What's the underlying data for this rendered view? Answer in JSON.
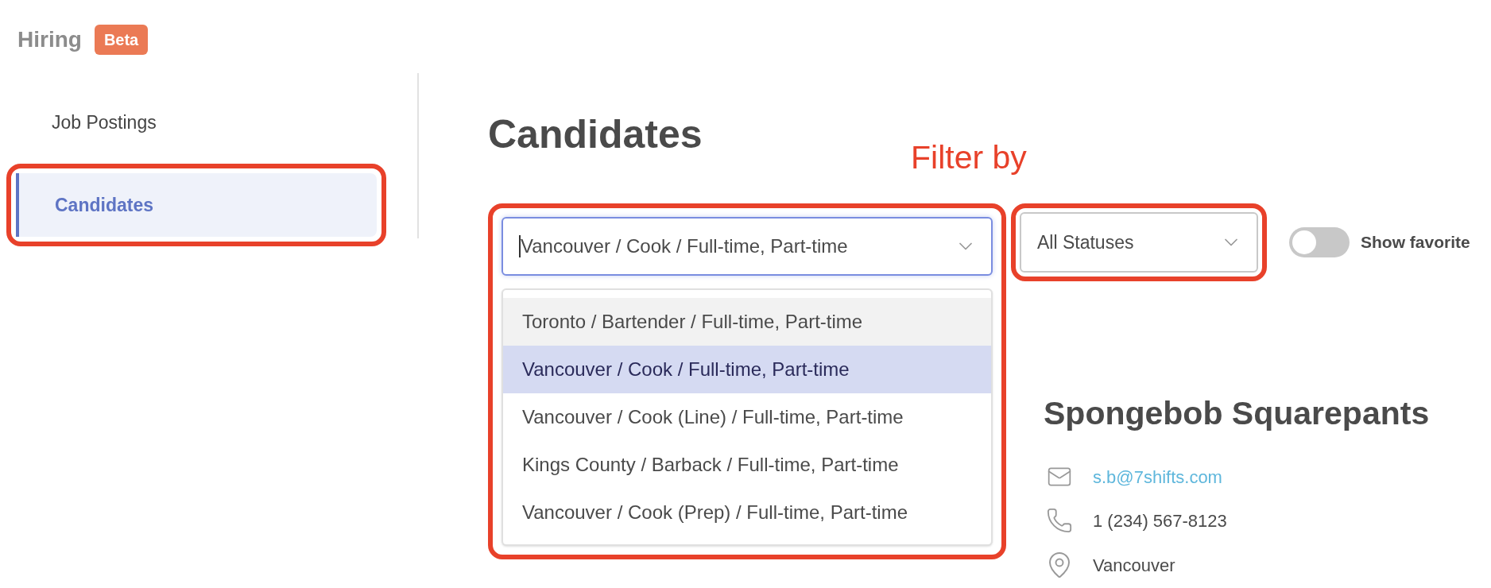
{
  "header": {
    "title": "Hiring",
    "badge": "Beta"
  },
  "sidebar": {
    "items": [
      {
        "label": "Job Postings",
        "selected": false,
        "highlighted": false
      },
      {
        "label": "Candidates",
        "selected": true,
        "highlighted": true
      }
    ]
  },
  "page_title": "Candidates",
  "annotation": "Filter by",
  "job_filter": {
    "value": "Vancouver / Cook / Full-time, Part-time",
    "focused": true,
    "expanded": true,
    "highlighted": true,
    "options": [
      {
        "label": "Toronto / Bartender / Full-time, Part-time",
        "selected": false,
        "hovered": true
      },
      {
        "label": "Vancouver / Cook / Full-time, Part-time",
        "selected": true,
        "hovered": false
      },
      {
        "label": "Vancouver / Cook (Line) / Full-time, Part-time",
        "selected": false,
        "hovered": false
      },
      {
        "label": "Kings County / Barback / Full-time, Part-time",
        "selected": false,
        "hovered": false
      },
      {
        "label": "Vancouver / Cook (Prep) / Full-time, Part-time",
        "selected": false,
        "hovered": false
      }
    ]
  },
  "status_filter": {
    "value": "All Statuses",
    "highlighted": true
  },
  "favorites_toggle": {
    "label": "Show favorite",
    "on": false
  },
  "candidate": {
    "name": "Spongebob Squarepants",
    "email": "s.b@7shifts.com",
    "phone": "1 (234) 567-8123",
    "location": "Vancouver"
  }
}
